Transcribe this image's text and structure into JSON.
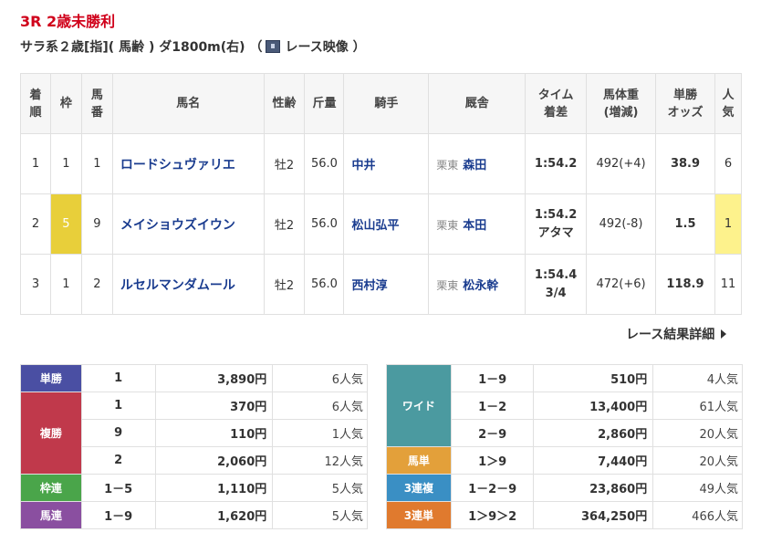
{
  "race": {
    "title": "3R 2歳未勝利",
    "conditions": "サラ系２歳[指]( 馬齢 ) ダ1800m(右) （",
    "video_label": "レース映像 ）"
  },
  "table_headers": {
    "rank": [
      "着",
      "順"
    ],
    "waku": "枠",
    "umaban": [
      "馬",
      "番"
    ],
    "horse": "馬名",
    "sex_age": "性齢",
    "weight": "斤量",
    "jockey": "騎手",
    "trainer": "厩舎",
    "time": [
      "タイム",
      "着差"
    ],
    "body_weight": [
      "馬体重",
      "(増減)"
    ],
    "odds": [
      "単勝",
      "オッズ"
    ],
    "pop": [
      "人",
      "気"
    ]
  },
  "results": [
    {
      "rank": "1",
      "waku": "1",
      "umaban": "1",
      "horse": "ロードシュヴァリエ",
      "sex_age": "牡2",
      "weight": "56.0",
      "jockey": "中井",
      "region": "栗東",
      "trainer": "森田",
      "time": "1:54.2",
      "margin": "",
      "body_weight": "492(+4)",
      "odds": "38.9",
      "pop": "6"
    },
    {
      "rank": "2",
      "waku": "5",
      "umaban": "9",
      "horse": "メイショウズイウン",
      "sex_age": "牡2",
      "weight": "56.0",
      "jockey": "松山弘平",
      "region": "栗東",
      "trainer": "本田",
      "time": "1:54.2",
      "margin": "アタマ",
      "body_weight": "492(-8)",
      "odds": "1.5",
      "pop": "1"
    },
    {
      "rank": "3",
      "waku": "1",
      "umaban": "2",
      "horse": "ルセルマンダムール",
      "sex_age": "牡2",
      "weight": "56.0",
      "jockey": "西村淳",
      "region": "栗東",
      "trainer": "松永幹",
      "time": "1:54.4",
      "margin": "3/4",
      "body_weight": "472(+6)",
      "odds": "118.9",
      "pop": "11"
    }
  ],
  "detail_link": "レース結果詳細",
  "payouts_left": [
    {
      "type": "単勝",
      "color": "#4a4fa3",
      "rows": [
        {
          "combo": "1",
          "amount": "3,890円",
          "pop": "6人気"
        }
      ]
    },
    {
      "type": "複勝",
      "color": "#c0394b",
      "rows": [
        {
          "combo": "1",
          "amount": "370円",
          "pop": "6人気"
        },
        {
          "combo": "9",
          "amount": "110円",
          "pop": "1人気"
        },
        {
          "combo": "2",
          "amount": "2,060円",
          "pop": "12人気"
        }
      ]
    },
    {
      "type": "枠連",
      "color": "#4aa54a",
      "rows": [
        {
          "combo": "1－5",
          "amount": "1,110円",
          "pop": "5人気"
        }
      ]
    },
    {
      "type": "馬連",
      "color": "#8a4fa0",
      "rows": [
        {
          "combo": "1－9",
          "amount": "1,620円",
          "pop": "5人気"
        }
      ]
    }
  ],
  "payouts_right": [
    {
      "type": "ワイド",
      "color": "#4b9aa0",
      "rows": [
        {
          "combo": "1－9",
          "amount": "510円",
          "pop": "4人気"
        },
        {
          "combo": "1－2",
          "amount": "13,400円",
          "pop": "61人気"
        },
        {
          "combo": "2－9",
          "amount": "2,860円",
          "pop": "20人気"
        }
      ]
    },
    {
      "type": "馬単",
      "color": "#e3a03a",
      "rows": [
        {
          "combo": "1＞9",
          "amount": "7,440円",
          "pop": "20人気"
        }
      ]
    },
    {
      "type": "3連複",
      "color": "#3a8fc4",
      "rows": [
        {
          "combo": "1－2－9",
          "amount": "23,860円",
          "pop": "49人気"
        }
      ]
    },
    {
      "type": "3連単",
      "color": "#e07a2e",
      "rows": [
        {
          "combo": "1＞9＞2",
          "amount": "364,250円",
          "pop": "466人気"
        }
      ]
    }
  ],
  "colors": {
    "title_red": "#d0021b",
    "link_blue": "#1a3c8f",
    "waku5_yellow": "#e8cf3a",
    "pop_highlight": "#fdf28c"
  }
}
